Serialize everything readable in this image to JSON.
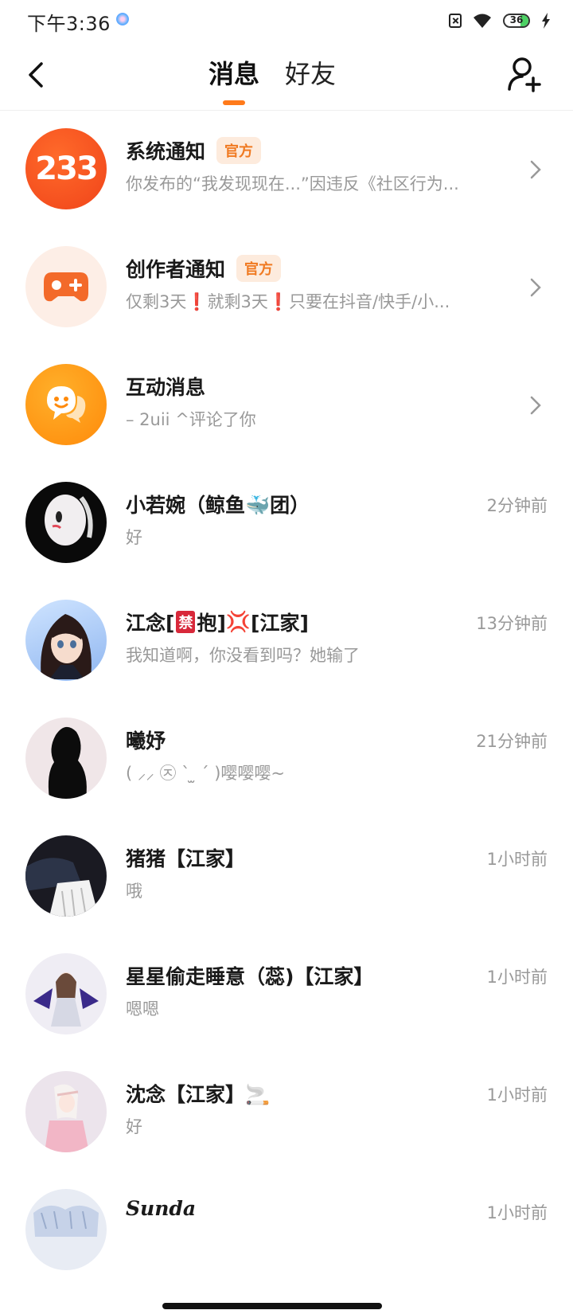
{
  "status_bar": {
    "time": "下午3:36",
    "battery": "36"
  },
  "header": {
    "tabs": [
      {
        "label": "消息",
        "active": true
      },
      {
        "label": "好友",
        "active": false
      }
    ]
  },
  "official_items": [
    {
      "name": "系统通知",
      "badge": "官方",
      "preview": "你发布的“我发现现在...”因违反《社区行为...",
      "avatar_text": "233"
    },
    {
      "name": "创作者通知",
      "badge": "官方",
      "preview_parts": [
        "仅剩3天",
        "❗",
        "就剩3天",
        "❗",
        "只要在抖音/快手/小..."
      ]
    },
    {
      "name": "互动消息",
      "preview": "– 2uii ^评论了你"
    }
  ],
  "conversations": [
    {
      "name": "小若婉（鲸鱼🐳团）",
      "preview": "好",
      "time": "2分钟前"
    },
    {
      "name_parts": [
        "江念[",
        "禁",
        "抱]",
        "💢",
        "[江家]"
      ],
      "preview": "我知道啊，你没看到吗？她输了",
      "time": "13分钟前"
    },
    {
      "name": "曦妤",
      "preview": "( ⸝⸝ ㉨ ˋ ̫ ˊ )嘤嘤嘤~",
      "time": "21分钟前"
    },
    {
      "name": "猪猪【江家】",
      "preview": "哦",
      "time": "1小时前"
    },
    {
      "name": "星星偷走睡意（蕊)【江家】",
      "preview": "嗯嗯",
      "time": "1小时前"
    },
    {
      "name": "沈念【江家】🚬",
      "preview": "好",
      "time": "1小时前"
    },
    {
      "name": "Sunda",
      "preview": "",
      "time": "1小时前"
    }
  ],
  "colors": {
    "accent": "#ff7a1a",
    "badge_text": "#f07a22",
    "badge_bg": "#fdebdd",
    "secondary_text": "#999999"
  },
  "icons": [
    "back-arrow-icon",
    "add-friend-icon",
    "chevron-right-icon",
    "wifi-icon",
    "battery-icon",
    "charging-bolt-icon",
    "sim-error-icon"
  ]
}
